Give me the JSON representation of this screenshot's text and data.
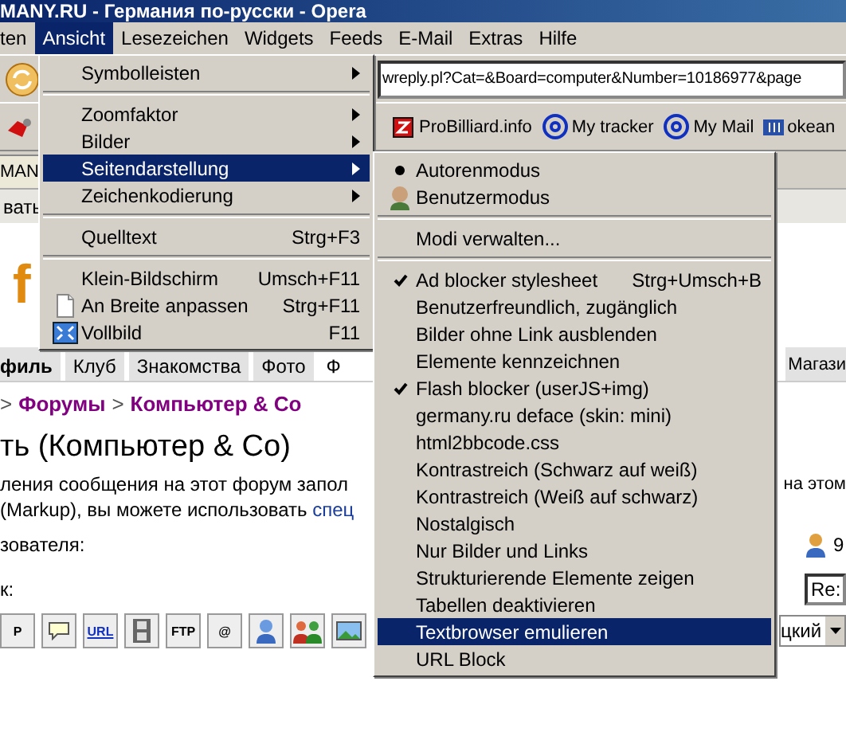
{
  "window": {
    "title": "MANY.RU - Германия по-русски - Opera"
  },
  "menubar": [
    {
      "label": "ten",
      "selected": false
    },
    {
      "label": "Ansicht",
      "selected": true
    },
    {
      "label": "Lesezeichen",
      "selected": false
    },
    {
      "label": "Widgets",
      "selected": false
    },
    {
      "label": "Feeds",
      "selected": false
    },
    {
      "label": "E-Mail",
      "selected": false
    },
    {
      "label": "Extras",
      "selected": false
    },
    {
      "label": "Hilfe",
      "selected": false
    }
  ],
  "address": {
    "value": "wreply.pl?Cat=&Board=computer&Number=10186977&page"
  },
  "bookmarks": [
    {
      "kind": "pin"
    },
    {
      "label": "ProBilliard.info",
      "kind": "z"
    },
    {
      "label": "My tracker",
      "kind": "at"
    },
    {
      "label": "My Mail",
      "kind": "at"
    },
    {
      "label": "okean",
      "kind": "book"
    }
  ],
  "tab": {
    "label": "MAN"
  },
  "info_bar": {
    "text": "вать"
  },
  "page": {
    "logo": "f",
    "nav_tabs": [
      {
        "label": "филь",
        "bold": true,
        "selected": false
      },
      {
        "label": "Клуб",
        "bold": false,
        "selected": false
      },
      {
        "label": "Знакомства",
        "bold": false,
        "selected": false
      },
      {
        "label": "Фото",
        "bold": false,
        "selected": false
      },
      {
        "label": "Ф",
        "bold": false,
        "selected": true
      }
    ],
    "nav_tab_right": "Магази",
    "breadcrumb": [
      {
        "kind": "sep",
        "label": ">"
      },
      {
        "kind": "link",
        "label": "Форумы"
      },
      {
        "kind": "sep",
        "label": ">"
      },
      {
        "kind": "link",
        "label": "Компьютер & Co"
      }
    ],
    "heading": "ть (Компьютер & Co)",
    "paragraph_line_1": "ления сообщения на этот форум запол",
    "paragraph_line_1_right": "на этом",
    "paragraph_line_2": "(Markup), вы можете использовать ",
    "paragraph_link": "спец",
    "user_label": "зователя:",
    "user_value": "9",
    "subject_label": "к:",
    "subject_value": "Re:",
    "format_buttons": [
      {
        "kind": "text",
        "label": "P"
      },
      {
        "kind": "quote"
      },
      {
        "kind": "link",
        "label": "URL"
      },
      {
        "kind": "video"
      },
      {
        "kind": "text",
        "label": "FTP"
      },
      {
        "kind": "text",
        "label": "@"
      },
      {
        "kind": "user"
      },
      {
        "kind": "group"
      },
      {
        "kind": "image"
      }
    ],
    "language_select": "цкий"
  },
  "view_menu": [
    {
      "kind": "submenu",
      "label": "Symbolleisten",
      "selected": false
    },
    {
      "kind": "separator"
    },
    {
      "kind": "submenu",
      "label": "Zoomfaktor",
      "selected": false
    },
    {
      "kind": "submenu",
      "label": "Bilder",
      "selected": false
    },
    {
      "kind": "submenu",
      "label": "Seitendarstellung",
      "selected": true
    },
    {
      "kind": "submenu",
      "label": "Zeichenkodierung",
      "selected": false
    },
    {
      "kind": "separator"
    },
    {
      "kind": "command",
      "label": "Quelltext",
      "shortcut": "Strg+F3",
      "selected": false
    },
    {
      "kind": "separator"
    },
    {
      "kind": "command",
      "label": "Klein-Bildschirm",
      "shortcut": "Umsch+F11",
      "selected": false
    },
    {
      "kind": "fit",
      "label": "An Breite anpassen",
      "shortcut": "Strg+F11",
      "selected": false
    },
    {
      "kind": "fullscreen",
      "label": "Vollbild",
      "shortcut": "F11",
      "selected": false
    }
  ],
  "display_submenu": [
    {
      "kind": "radio",
      "label": "Autorenmodus",
      "checked": true,
      "selected": false
    },
    {
      "kind": "user",
      "label": "Benutzermodus",
      "selected": false
    },
    {
      "kind": "separator"
    },
    {
      "kind": "command",
      "label": "Modi verwalten...",
      "selected": false
    },
    {
      "kind": "separator"
    },
    {
      "kind": "check",
      "label": "Ad blocker stylesheet",
      "shortcut": "Strg+Umsch+B",
      "checked": true,
      "selected": false
    },
    {
      "kind": "check",
      "label": "Benutzerfreundlich, zugänglich",
      "checked": false,
      "selected": false
    },
    {
      "kind": "check",
      "label": "Bilder ohne Link ausblenden",
      "checked": false,
      "selected": false
    },
    {
      "kind": "check",
      "label": "Elemente kennzeichnen",
      "checked": false,
      "selected": false
    },
    {
      "kind": "check",
      "label": "Flash blocker (userJS+img)",
      "checked": true,
      "selected": false
    },
    {
      "kind": "check",
      "label": "germany.ru deface (skin: mini)",
      "checked": false,
      "selected": false
    },
    {
      "kind": "check",
      "label": "html2bbcode.css",
      "checked": false,
      "selected": false
    },
    {
      "kind": "check",
      "label": "Kontrastreich (Schwarz auf weiß)",
      "checked": false,
      "selected": false
    },
    {
      "kind": "check",
      "label": "Kontrastreich (Weiß auf schwarz)",
      "checked": false,
      "selected": false
    },
    {
      "kind": "check",
      "label": "Nostalgisch",
      "checked": false,
      "selected": false
    },
    {
      "kind": "check",
      "label": "Nur Bilder und Links",
      "checked": false,
      "selected": false
    },
    {
      "kind": "check",
      "label": "Strukturierende Elemente zeigen",
      "checked": false,
      "selected": false
    },
    {
      "kind": "check",
      "label": "Tabellen deaktivieren",
      "checked": false,
      "selected": false
    },
    {
      "kind": "check",
      "label": "Textbrowser emulieren",
      "checked": false,
      "selected": true
    },
    {
      "kind": "check",
      "label": "URL Block",
      "checked": false,
      "selected": false
    }
  ]
}
